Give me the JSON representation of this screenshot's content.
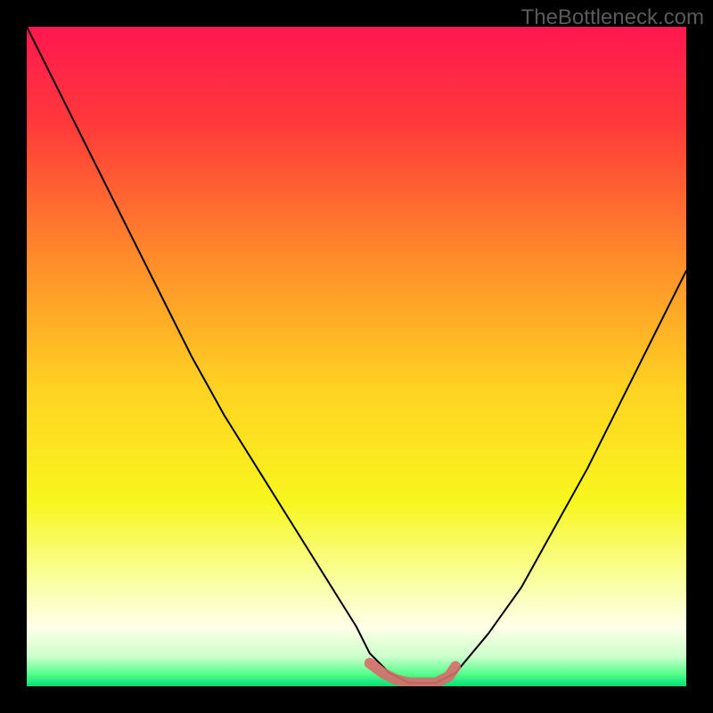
{
  "watermark": "TheBottleneck.com",
  "chart_data": {
    "type": "line",
    "title": "",
    "xlabel": "",
    "ylabel": "",
    "xlim": [
      0,
      100
    ],
    "ylim": [
      0,
      100
    ],
    "series": [
      {
        "name": "curve-primary",
        "x_values": [
          0,
          5,
          10,
          15,
          20,
          25,
          30,
          35,
          40,
          45,
          50,
          52,
          55,
          58,
          60,
          62,
          65,
          70,
          75,
          80,
          85,
          90,
          95,
          100
        ],
        "y_values": [
          100,
          90,
          80,
          70,
          60,
          50,
          41,
          33,
          25,
          17,
          9,
          5,
          2,
          0.5,
          0.5,
          0.5,
          2,
          8,
          15,
          24,
          33,
          43,
          53,
          63
        ]
      },
      {
        "name": "valley-overlay",
        "x_values": [
          52,
          54,
          56,
          58,
          60,
          62,
          64,
          65
        ],
        "y_values": [
          3.5,
          2,
          1,
          0.5,
          0.5,
          0.5,
          1.5,
          3
        ]
      }
    ],
    "gradient_stops": [
      {
        "offset": 0.0,
        "color": "#ff1750"
      },
      {
        "offset": 0.15,
        "color": "#ff3a3a"
      },
      {
        "offset": 0.35,
        "color": "#ff8b2a"
      },
      {
        "offset": 0.55,
        "color": "#ffd322"
      },
      {
        "offset": 0.72,
        "color": "#f8f61e"
      },
      {
        "offset": 0.84,
        "color": "#f9ffa0"
      },
      {
        "offset": 0.91,
        "color": "#ffffe8"
      },
      {
        "offset": 0.955,
        "color": "#ccffcc"
      },
      {
        "offset": 0.98,
        "color": "#5bff8f"
      },
      {
        "offset": 1.0,
        "color": "#00e074"
      }
    ],
    "colors": {
      "curve": "#000000",
      "overlay": "#d96a6a",
      "frame": "#000000"
    }
  }
}
